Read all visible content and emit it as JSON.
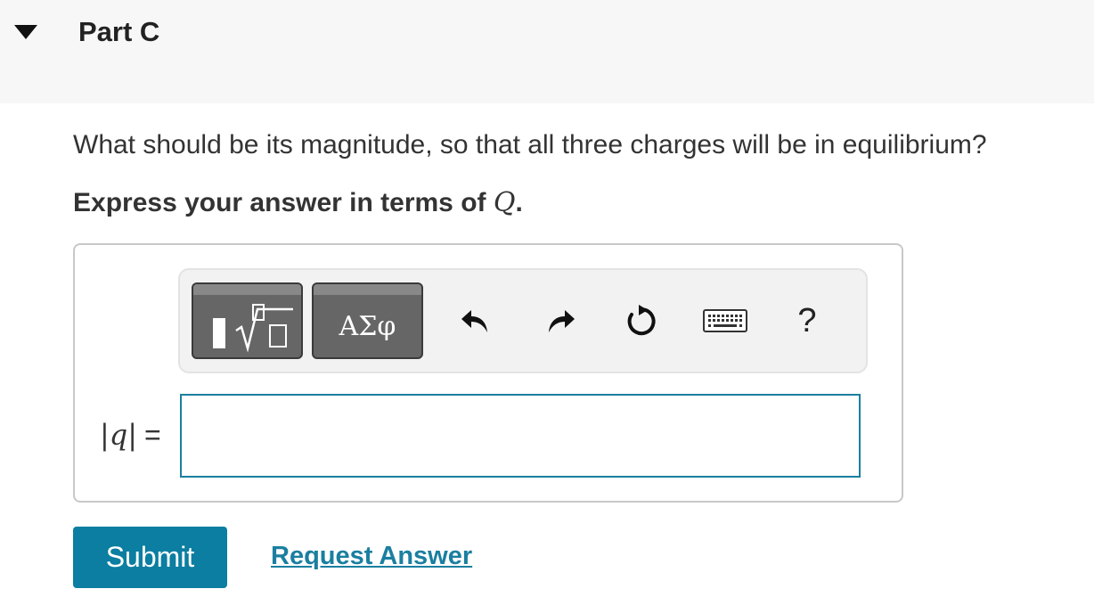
{
  "part": {
    "title": "Part C"
  },
  "question": {
    "text": "What should be its magnitude, so that all three charges will be in equilibrium?",
    "instruction_prefix": "Express your answer in terms of ",
    "instruction_variable": "Q",
    "instruction_suffix": "."
  },
  "toolbar": {
    "templates_icon": "templates-radical-icon",
    "symbols_label": "ΑΣφ",
    "undo_icon": "undo-icon",
    "redo_icon": "redo-icon",
    "reset_icon": "reset-icon",
    "keyboard_icon": "keyboard-icon",
    "help_label": "?"
  },
  "answer": {
    "variable_label": "|q|",
    "equals": "=",
    "value": ""
  },
  "actions": {
    "submit_label": "Submit",
    "request_answer_label": "Request Answer"
  },
  "colors": {
    "accent": "#0b7ea1",
    "link": "#1a7fa0",
    "toolbar_button": "#666666",
    "header_bg": "#f7f7f7"
  }
}
